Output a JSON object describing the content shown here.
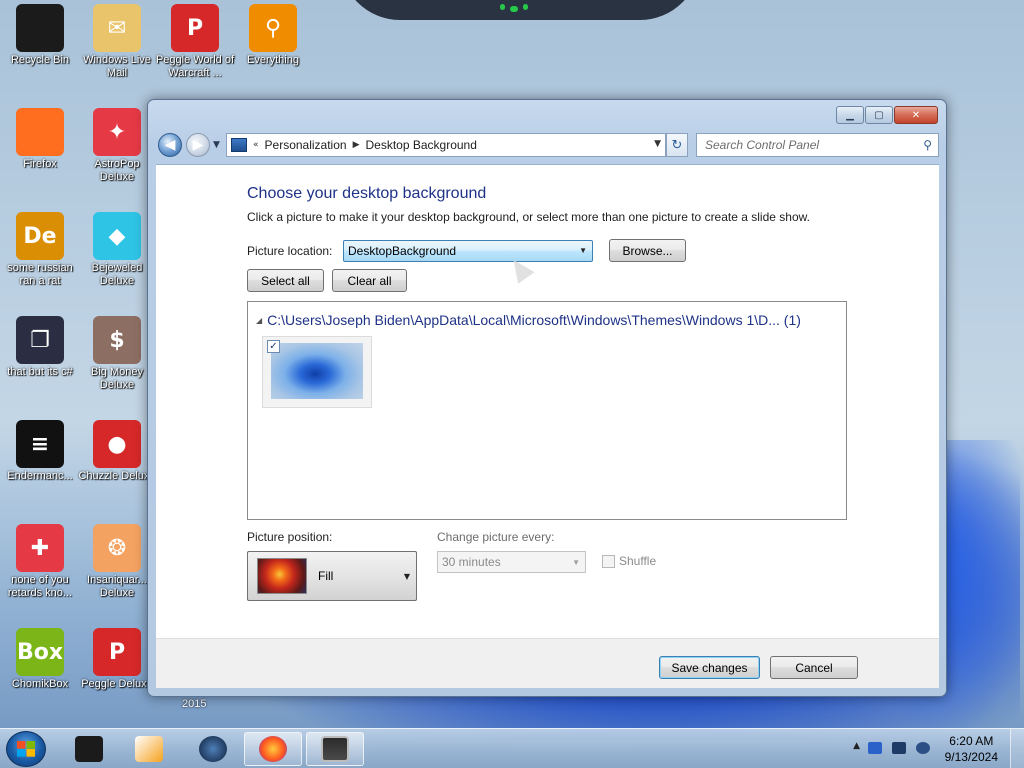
{
  "desktop": {
    "icons": [
      {
        "label": "Recycle Bin",
        "icon": "recycle-bin-icon",
        "color": "#1b1b1b",
        "glyph": ""
      },
      {
        "label": "Windows Live Mail",
        "icon": "mail-icon",
        "color": "#e9c46a",
        "glyph": "✉"
      },
      {
        "label": "Peggle World of Warcraft ...",
        "icon": "peggle-icon",
        "color": "#d62828",
        "glyph": "P"
      },
      {
        "label": "Everything",
        "icon": "magnifier-icon",
        "color": "#f08c00",
        "glyph": "⚲"
      },
      {
        "label": "Firefox",
        "icon": "firefox-icon",
        "color": "#ff6d1f",
        "glyph": ""
      },
      {
        "label": "AstroPop Deluxe",
        "icon": "astropop-icon",
        "color": "#e63946",
        "glyph": "✦"
      },
      {
        "label": "some russian ran a rat",
        "icon": "de-icon",
        "color": "#d98e04",
        "glyph": "De"
      },
      {
        "label": "Bejeweled Deluxe",
        "icon": "gem-icon",
        "color": "#2ec4e6",
        "glyph": "◆"
      },
      {
        "label": "that but its c#",
        "icon": "windows-stack-icon",
        "color": "#2b2d42",
        "glyph": "❐"
      },
      {
        "label": "Big Money Deluxe",
        "icon": "money-bag-icon",
        "color": "#8d6e63",
        "glyph": "$"
      },
      {
        "label": "Endermanc...",
        "icon": "terminal-icon",
        "color": "#111111",
        "glyph": "≡"
      },
      {
        "label": "Chuzzle Deluxe",
        "icon": "chuzzle-icon",
        "color": "#d62828",
        "glyph": "●"
      },
      {
        "label": "none of you retards kno...",
        "icon": "dino-icon",
        "color": "#e63946",
        "glyph": "✚"
      },
      {
        "label": "Insaniquar... Deluxe",
        "icon": "fish-icon",
        "color": "#f4a261",
        "glyph": "❂"
      },
      {
        "label": "ChomikBox",
        "icon": "chomikbox-icon",
        "color": "#7cb518",
        "glyph": "Box"
      },
      {
        "label": "Peggle Deluxe",
        "icon": "peggle-deluxe-icon",
        "color": "#d62828",
        "glyph": "P"
      }
    ],
    "year_label": "2015"
  },
  "window": {
    "controls": {
      "minimize": "▁",
      "maximize": "▢",
      "close": "✕"
    },
    "nav": {
      "back_glyph": "◀",
      "forward_glyph": "▶",
      "history_glyph": "▼",
      "refresh_glyph": "↻"
    },
    "address": {
      "prefix": "«",
      "crumbs": [
        "Personalization",
        "Desktop Background"
      ],
      "separator": "▶",
      "drop": "▼"
    },
    "search": {
      "placeholder": "Search Control Panel",
      "icon": "⚲"
    },
    "title": "Choose your desktop background",
    "description": "Click a picture to make it your desktop background, or select more than one picture to create a slide show.",
    "picture_location": {
      "label": "Picture location:",
      "value": "DesktopBackground",
      "arrow": "▼"
    },
    "browse_label": "Browse...",
    "select_all_label": "Select all",
    "clear_all_label": "Clear all",
    "gallery": {
      "group_toggle": "◢",
      "group_header": "C:\\Users\\Joseph Biden\\AppData\\Local\\Microsoft\\Windows\\Themes\\Windows 1\\D... (1)",
      "thumbnail_checked": "✓"
    },
    "picture_position": {
      "label": "Picture position:",
      "value": "Fill",
      "arrow": "▼"
    },
    "change_every": {
      "label": "Change picture every:",
      "value": "30 minutes",
      "arrow": "▼"
    },
    "shuffle_label": "Shuffle",
    "save_label": "Save changes",
    "cancel_label": "Cancel"
  },
  "taskbar": {
    "start": "start-button",
    "clock_time": "6:20 AM",
    "clock_date": "9/13/2024",
    "tray_arrow": "▲"
  },
  "colors": {
    "accent_title": "#1e3287",
    "taskbar": "#a0bad6"
  }
}
